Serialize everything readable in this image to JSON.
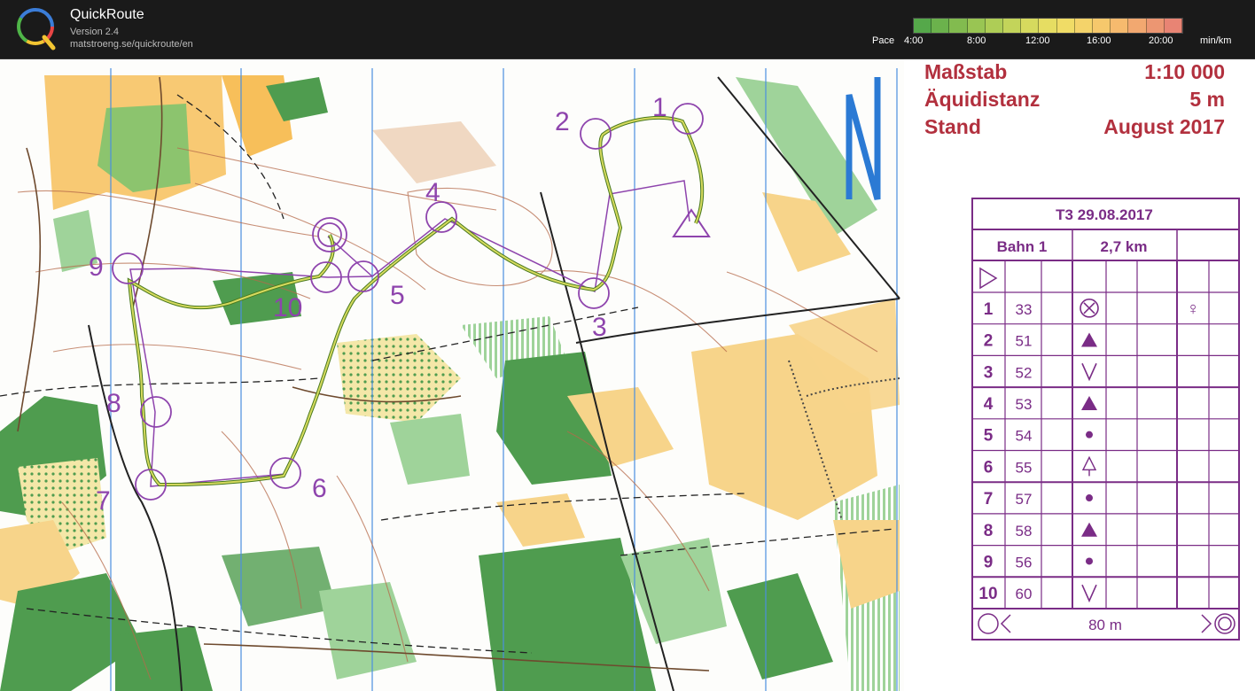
{
  "app": {
    "title": "QuickRoute",
    "version": "Version 2.4",
    "url": "matstroeng.se/quickroute/en"
  },
  "pace_scale": {
    "label": "Pace",
    "ticks": [
      "4:00",
      "8:00",
      "12:00",
      "16:00",
      "20:00"
    ],
    "unit": "min/km",
    "colors": [
      "#55a84a",
      "#6bb24c",
      "#82bb4f",
      "#99c553",
      "#aecd56",
      "#c3d45a",
      "#d6da5e",
      "#e6dd62",
      "#f0dc66",
      "#f4d36a",
      "#f6c86c",
      "#f6ba6e",
      "#f2a870",
      "#ec9672",
      "#e88474"
    ]
  },
  "map_legend": {
    "scale_label": "Maßstab",
    "scale_value": "1:10 000",
    "contour_label": "Äquidistanz",
    "contour_value": "5 m",
    "date_label": "Stand",
    "date_value": "August 2017"
  },
  "control_description": {
    "event": "T3 29.08.2017",
    "course": "Bahn 1",
    "length": "2,7 km",
    "rows": [
      {
        "num": "1",
        "code": "33",
        "symbol": "circle-x-icon",
        "extra": "♀"
      },
      {
        "num": "2",
        "code": "51",
        "symbol": "triangle-icon",
        "extra": ""
      },
      {
        "num": "3",
        "code": "52",
        "symbol": "v-icon",
        "extra": ""
      },
      {
        "num": "4",
        "code": "53",
        "symbol": "triangle-icon",
        "extra": ""
      },
      {
        "num": "5",
        "code": "54",
        "symbol": "dot-icon",
        "extra": ""
      },
      {
        "num": "6",
        "code": "55",
        "symbol": "tree-icon",
        "extra": ""
      },
      {
        "num": "7",
        "code": "57",
        "symbol": "dot-icon",
        "extra": ""
      },
      {
        "num": "8",
        "code": "58",
        "symbol": "triangle-icon",
        "extra": ""
      },
      {
        "num": "9",
        "code": "56",
        "symbol": "dot-icon",
        "extra": ""
      },
      {
        "num": "10",
        "code": "60",
        "symbol": "v-icon",
        "extra": ""
      }
    ],
    "finish_distance": "80 m"
  },
  "course_controls": [
    {
      "label": "1"
    },
    {
      "label": "2"
    },
    {
      "label": "3"
    },
    {
      "label": "4"
    },
    {
      "label": "5"
    },
    {
      "label": "6"
    },
    {
      "label": "7"
    },
    {
      "label": "8"
    },
    {
      "label": "9"
    },
    {
      "label": "10"
    }
  ]
}
